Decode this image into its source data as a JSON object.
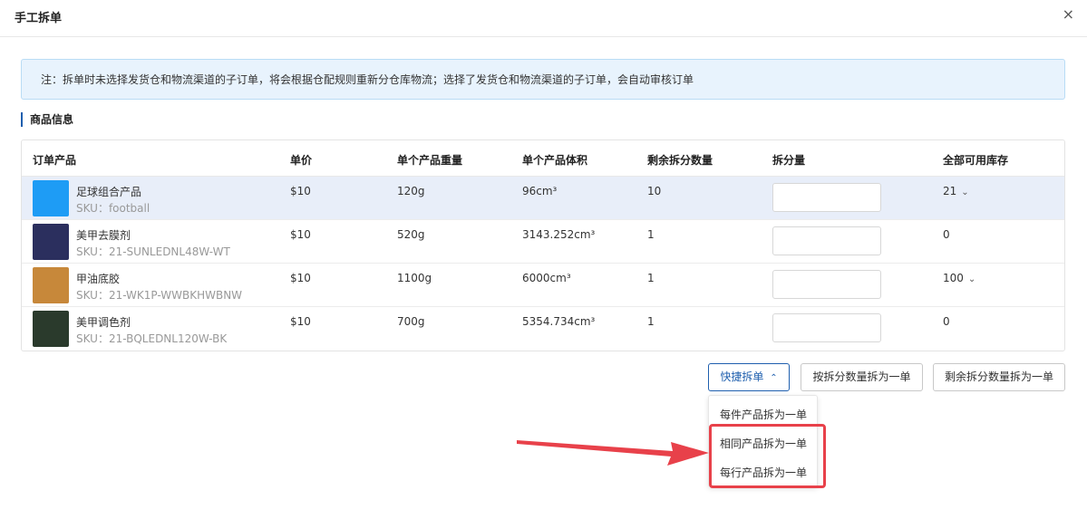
{
  "dialog": {
    "title": "手工拆单",
    "close_glyph": "×"
  },
  "notice": {
    "text": "注：拆单时未选择发货仓和物流渠道的子订单，将会根据仓配规则重新分仓库物流；选择了发货仓和物流渠道的子订单，会自动审核订单"
  },
  "section": {
    "title": "商品信息"
  },
  "table": {
    "headers": {
      "product": "订单产品",
      "price": "单价",
      "weight": "单个产品重量",
      "volume": "单个产品体积",
      "remaining": "剩余拆分数量",
      "split_qty": "拆分量",
      "stock": "全部可用库存"
    },
    "rows": [
      {
        "name": "足球组合产品",
        "sku": "SKU：football",
        "price": "$10",
        "weight": "120g",
        "volume": "96cm³",
        "remaining": "10",
        "stock": "21",
        "thumb_color": "#1e9cf5",
        "highlighted": true,
        "stock_dropdown": true
      },
      {
        "name": "美甲去膜剂",
        "sku": "SKU：21-SUNLEDNL48W-WT",
        "price": "$10",
        "weight": "520g",
        "volume": "3143.252cm³",
        "remaining": "1",
        "stock": "0",
        "thumb_color": "#2b2f5e",
        "highlighted": false,
        "stock_dropdown": false
      },
      {
        "name": "甲油底胶",
        "sku": "SKU：21-WK1P-WWBKHWBNW",
        "price": "$10",
        "weight": "1100g",
        "volume": "6000cm³",
        "remaining": "1",
        "stock": "100",
        "thumb_color": "#c7883a",
        "highlighted": false,
        "stock_dropdown": true
      },
      {
        "name": "美甲调色剂",
        "sku": "SKU：21-BQLEDNL120W-BK",
        "price": "$10",
        "weight": "700g",
        "volume": "5354.734cm³",
        "remaining": "1",
        "stock": "0",
        "thumb_color": "#2a3a2c",
        "highlighted": false,
        "stock_dropdown": false
      }
    ]
  },
  "actions": {
    "quick_split": "快捷拆单",
    "quick_split_chevron": "⌃",
    "split_by_qty": "按拆分数量拆为一单",
    "split_remaining": "剩余拆分数量拆为一单"
  },
  "dropdown": {
    "options": [
      "每件产品拆为一单",
      "相同产品拆为一单",
      "每行产品拆为一单"
    ]
  },
  "icons": {
    "chevron_down": "⌄"
  },
  "colors": {
    "accent": "#1f5fae",
    "annotation_red": "#e8414a",
    "notice_bg": "#e8f3fd",
    "row_highlight": "#e8eef9"
  }
}
